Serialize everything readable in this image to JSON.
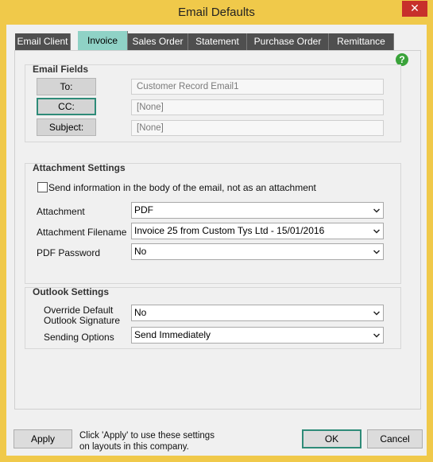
{
  "window": {
    "title": "Email Defaults",
    "close_glyph": "✕"
  },
  "tabs": [
    {
      "label": "Email Client"
    },
    {
      "label": "Invoice"
    },
    {
      "label": "Sales Order"
    },
    {
      "label": "Statement"
    },
    {
      "label": "Purchase Order"
    },
    {
      "label": "Remittance"
    }
  ],
  "active_tab": "Invoice",
  "help": {
    "glyph": "?",
    "icon": "help-icon"
  },
  "email_fields": {
    "title": "Email Fields",
    "rows": [
      {
        "button": "To:",
        "value": "Customer Record Email1"
      },
      {
        "button": "CC:",
        "value": "[None]"
      },
      {
        "button": "Subject:",
        "value": "[None]"
      }
    ]
  },
  "attachment_settings": {
    "title": "Attachment Settings",
    "body_checkbox_label": "Send information in the body of the email, not as an attachment",
    "body_checkbox_checked": false,
    "attachment_label": "Attachment",
    "attachment_value": "PDF",
    "filename_label": "Attachment Filename",
    "filename_value": "Invoice 25 from Custom Tys Ltd - 15/01/2016",
    "password_label": "PDF Password",
    "password_value": "No"
  },
  "outlook_settings": {
    "title": "Outlook Settings",
    "signature_label_line1": "Override Default",
    "signature_label_line2": "Outlook Signature",
    "signature_value": "No",
    "sending_label": "Sending Options",
    "sending_value": "Send Immediately"
  },
  "footer": {
    "apply_label": "Apply",
    "note_line1": "Click 'Apply' to use these settings",
    "note_line2": "on layouts in this company.",
    "ok_label": "OK",
    "cancel_label": "Cancel"
  },
  "colors": {
    "title_bar": "#f0c94a",
    "close_button": "#c7302b",
    "tab_inactive": "#4f4f4f",
    "tab_active": "#8fd2c6",
    "focus_border": "#2e8b78",
    "help_icon": "#3aa33a"
  }
}
